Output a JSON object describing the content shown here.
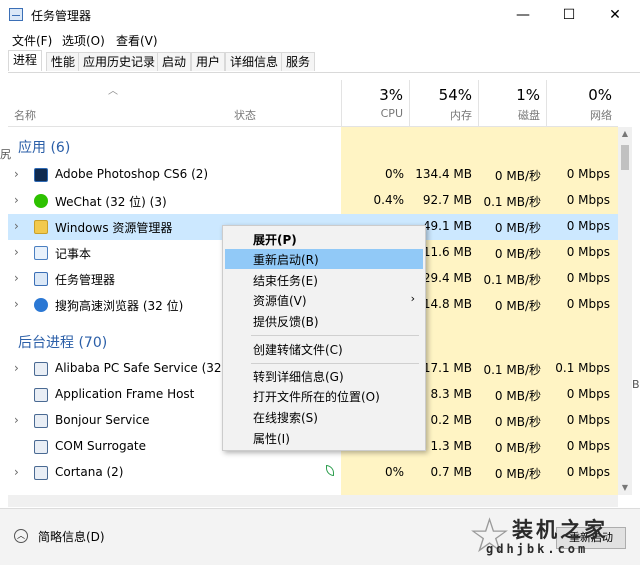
{
  "window": {
    "title": "任务管理器",
    "controls": [
      "—",
      "☐",
      "✕"
    ]
  },
  "menu": [
    "文件(F)",
    "选项(O)",
    "查看(V)"
  ],
  "tabs": [
    "进程",
    "性能",
    "应用历史记录",
    "启动",
    "用户",
    "详细信息",
    "服务"
  ],
  "header": {
    "name_label": "名称",
    "status_label": "状态",
    "cpu": {
      "pct": "3%",
      "label": "CPU"
    },
    "mem": {
      "pct": "54%",
      "label": "内存"
    },
    "disk": {
      "pct": "1%",
      "label": "磁盘"
    },
    "net": {
      "pct": "0%",
      "label": "网络"
    }
  },
  "edge_hints": {
    "left": "尻",
    "right": "B"
  },
  "groups": {
    "apps": "应用 (6)",
    "background": "后台进程 (70)"
  },
  "apps": [
    {
      "name": "Adobe Photoshop CS6 (2)",
      "icon": "photoshop-icon",
      "cpu": "0%",
      "mem": "134.4 MB",
      "disk": "0 MB/秒",
      "net": "0 Mbps"
    },
    {
      "name": "WeChat (32 位) (3)",
      "icon": "wechat-icon",
      "cpu": "0.4%",
      "mem": "92.7 MB",
      "disk": "0.1 MB/秒",
      "net": "0 Mbps"
    },
    {
      "name": "Windows 资源管理器",
      "icon": "folder-icon",
      "cpu": "",
      "mem": "49.1 MB",
      "disk": "0 MB/秒",
      "net": "0 Mbps"
    },
    {
      "name": "记事本",
      "icon": "notepad-icon",
      "cpu": "",
      "mem": "11.6 MB",
      "disk": "0 MB/秒",
      "net": "0 Mbps"
    },
    {
      "name": "任务管理器",
      "icon": "task-manager-icon",
      "cpu": "",
      "mem": "29.4 MB",
      "disk": "0.1 MB/秒",
      "net": "0 Mbps"
    },
    {
      "name": "搜狗高速浏览器 (32 位)",
      "icon": "browser-icon",
      "cpu": "",
      "mem": "14.8 MB",
      "disk": "0 MB/秒",
      "net": "0 Mbps"
    }
  ],
  "background": [
    {
      "name": "Alibaba PC Safe Service (32 ...",
      "icon": "service-icon",
      "cpu": "",
      "mem": "17.1 MB",
      "disk": "0.1 MB/秒",
      "net": "0.1 Mbps"
    },
    {
      "name": "Application Frame Host",
      "icon": "service-icon",
      "cpu": "",
      "mem": "8.3 MB",
      "disk": "0 MB/秒",
      "net": "0 Mbps"
    },
    {
      "name": "Bonjour Service",
      "icon": "service-icon",
      "cpu": "",
      "mem": "0.2 MB",
      "disk": "0 MB/秒",
      "net": "0 Mbps"
    },
    {
      "name": "COM Surrogate",
      "icon": "service-icon",
      "cpu": "",
      "mem": "1.3 MB",
      "disk": "0 MB/秒",
      "net": "0 Mbps"
    },
    {
      "name": "Cortana (2)",
      "icon": "service-icon",
      "cpu": "0%",
      "mem": "0.7 MB",
      "disk": "0 MB/秒",
      "net": "0 Mbps"
    }
  ],
  "context_menu": {
    "items": [
      "展开(P)",
      "重新启动(R)",
      "结束任务(E)",
      "资源值(V)",
      "提供反馈(B)",
      "创建转储文件(C)",
      "转到详细信息(G)",
      "打开文件所在的位置(O)",
      "在线搜索(S)",
      "属性(I)"
    ],
    "submenu_arrow": "›"
  },
  "footer": {
    "fewer_details": "简略信息(D)",
    "end_task": "重新启动"
  },
  "watermark": {
    "text": "装机之家",
    "url": "gdhjbk.com"
  },
  "colors": {
    "highlight": "#fff4c4",
    "selected_row": "#cce8ff",
    "group_title": "#2b5fa8",
    "menu_hover": "#91c9f7"
  }
}
